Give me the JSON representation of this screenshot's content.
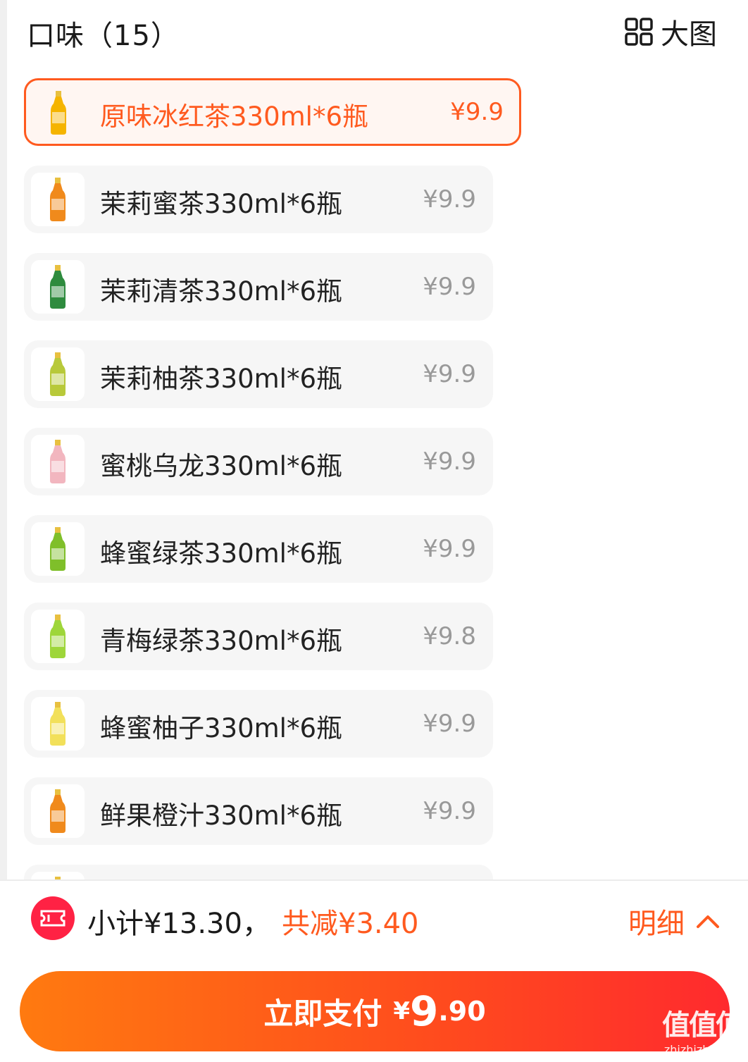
{
  "header": {
    "title": "口味（15）",
    "bigview_label": "大图"
  },
  "items": [
    {
      "name": "原味冰红茶330ml*6瓶",
      "price": "¥9.9",
      "selected": true,
      "color": "#f5b400"
    },
    {
      "name": "茉莉蜜茶330ml*6瓶",
      "price": "¥9.9",
      "selected": false,
      "color": "#f08a1c"
    },
    {
      "name": "茉莉清茶330ml*6瓶",
      "price": "¥9.9",
      "selected": false,
      "color": "#2e8b3e"
    },
    {
      "name": "茉莉柚茶330ml*6瓶",
      "price": "¥9.9",
      "selected": false,
      "color": "#b8c93a"
    },
    {
      "name": "蜜桃乌龙330ml*6瓶",
      "price": "¥9.9",
      "selected": false,
      "color": "#f2b6bf"
    },
    {
      "name": "蜂蜜绿茶330ml*6瓶",
      "price": "¥9.9",
      "selected": false,
      "color": "#7fbf2a"
    },
    {
      "name": "青梅绿茶330ml*6瓶",
      "price": "¥9.8",
      "selected": false,
      "color": "#9ed63a"
    },
    {
      "name": "蜂蜜柚子330ml*6瓶",
      "price": "¥9.9",
      "selected": false,
      "color": "#f2e05a"
    },
    {
      "name": "鲜果橙汁330ml*6瓶",
      "price": "¥9.9",
      "selected": false,
      "color": "#f08a1c"
    },
    {
      "name": "",
      "price": "",
      "selected": false,
      "color": "#dddddd"
    }
  ],
  "footer": {
    "subtotal": "小计¥13.30，",
    "discount": "共减¥3.40",
    "detail_label": "明细",
    "pay_label": "立即支付",
    "pay_currency": "¥",
    "pay_int": "9",
    "pay_dec": ".90"
  },
  "watermark": {
    "mark": "值值值",
    "url": "zhizhizhi.com"
  },
  "colors": {
    "accent": "#ff5a1f",
    "coupon": "#ff2244"
  }
}
